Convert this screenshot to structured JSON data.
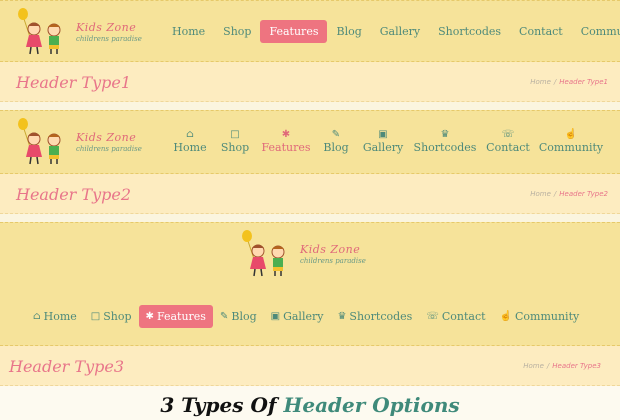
{
  "logo": {
    "name": "Kids Zone",
    "tagline": "childrens paradise"
  },
  "nav_items": [
    {
      "label": "Home",
      "icon": "home-icon",
      "glyph": "⌂"
    },
    {
      "label": "Shop",
      "icon": "cart-icon",
      "glyph": "🛒"
    },
    {
      "label": "Features",
      "icon": "gift-icon",
      "glyph": "✱",
      "active": true
    },
    {
      "label": "Blog",
      "icon": "pencil-icon",
      "glyph": "✎"
    },
    {
      "label": "Gallery",
      "icon": "image-icon",
      "glyph": "▣"
    },
    {
      "label": "Shortcodes",
      "icon": "trophy-icon",
      "glyph": "♛"
    },
    {
      "label": "Contact",
      "icon": "phone-icon",
      "glyph": "☏"
    },
    {
      "label": "Community",
      "icon": "thumbs-up-icon",
      "glyph": "☝"
    }
  ],
  "headers": [
    {
      "title": "Header Type1",
      "breadcrumb": [
        "Home",
        "Header Type1"
      ]
    },
    {
      "title": "Header Type2",
      "breadcrumb": [
        "Home",
        "Header Type2"
      ]
    },
    {
      "title": "Header Type3",
      "breadcrumb": [
        "Home",
        "Header Type3"
      ]
    }
  ],
  "caption": {
    "part1": "3 Types Of ",
    "part2": "Header Options"
  },
  "colors": {
    "nav_band": "#f6e39a",
    "title_band": "#fdecc0",
    "accent_pink": "#ee7480",
    "nav_text_teal": "#4e8a7a"
  }
}
